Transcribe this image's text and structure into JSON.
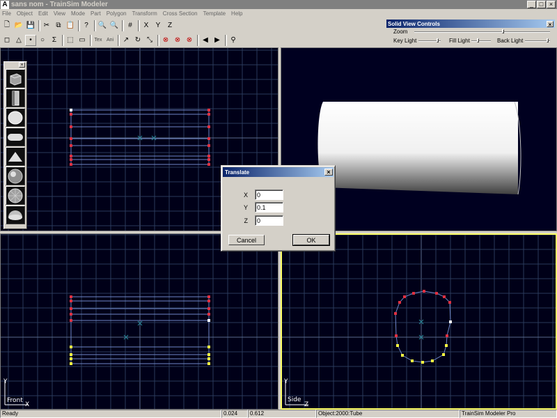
{
  "window": {
    "title": "sans nom - TrainSim Modeler",
    "app_icon": "A"
  },
  "menu": [
    "File",
    "Object",
    "Edit",
    "View",
    "Mode",
    "Part",
    "Polygon",
    "Transform",
    "Cross Section",
    "Template",
    "Help"
  ],
  "toolbar1": [
    "new-icon",
    "open-icon",
    "save-icon",
    "sep",
    "cut-icon",
    "copy-icon",
    "paste-icon",
    "sep",
    "help-icon",
    "sep",
    "zoom-in-icon",
    "zoom-out-icon",
    "sep",
    "grid-icon",
    "sep",
    "snap-x-icon",
    "snap-y-icon",
    "snap-z-icon"
  ],
  "toolbar1_glyphs": [
    "🗋",
    "📂",
    "💾",
    "",
    "✂",
    "⧉",
    "📋",
    "",
    "?",
    "",
    "🔍",
    "🔍",
    "",
    "#",
    "",
    "X",
    "Y",
    "Z"
  ],
  "toolbar2": [
    "select-face-icon",
    "select-tri-icon",
    "select-point-icon",
    "select-circle-icon",
    "sum-icon",
    "sep",
    "marquee-icon",
    "ruler-icon",
    "sep",
    "tex-icon",
    "ani-icon",
    "sep",
    "redo-icon",
    "rotate-icon",
    "scale-icon",
    "sep",
    "delete-x-icon",
    "delete-y-icon",
    "delete-z-icon",
    "sep",
    "prev-icon",
    "next-icon",
    "sep",
    "binoculars-icon"
  ],
  "toolbar2_glyphs": [
    "◻",
    "△",
    "•",
    "○",
    "Σ",
    "",
    "⬚",
    "▭",
    "",
    "Tex",
    "Ani",
    "",
    "↗",
    "↻",
    "⤡",
    "",
    "⊗",
    "⊗",
    "⊗",
    "",
    "◀",
    "▶",
    "",
    "⚲"
  ],
  "solid_view": {
    "title": "Solid View Controls",
    "zoom_label": "Zoom",
    "key_light_label": "Key Light",
    "fill_light_label": "Fill Light",
    "back_light_label": "Back Light"
  },
  "viewports": {
    "front_label": "Front",
    "side_label": "Side",
    "front_axis_y": "Y",
    "front_axis_x": "X",
    "side_axis_y": "Y",
    "side_axis_z": "Z"
  },
  "dialog": {
    "title": "Translate",
    "x_label": "X",
    "x_value": "0",
    "y_label": "Y",
    "y_value": "0.1",
    "z_label": "Z",
    "z_value": "0",
    "cancel_label": "Cancel",
    "ok_label": "OK"
  },
  "status": {
    "state": "Ready",
    "coord_x": "0.024",
    "coord_y": "0.612",
    "object": "Object:2000:Tube",
    "product": "TrainSim Modeler Pro"
  },
  "colors": {
    "viewport_bg": "#000018",
    "grid": "#2a3a5a",
    "outline": "#6f86c6",
    "vertex_red": "#e03040",
    "vertex_yellow": "#ffff40",
    "active_border": "#ffff66"
  }
}
